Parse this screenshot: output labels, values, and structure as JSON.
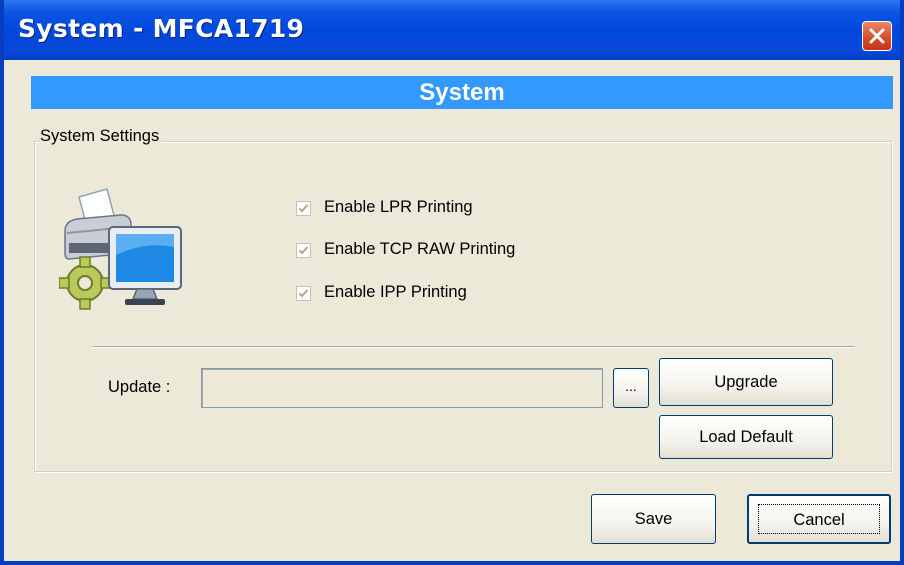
{
  "window": {
    "title": "System - MFCA1719",
    "close_icon": "close-icon",
    "titlebar_color": "#0A54E3",
    "close_color": "#D64A26"
  },
  "banner": {
    "text": "System",
    "color": "#3399FF"
  },
  "settings": {
    "legend": "System Settings",
    "icon": "printer-monitor-gear-icon",
    "options": [
      {
        "label": "Enable LPR Printing",
        "checked": true,
        "disabled": true
      },
      {
        "label": "Enable TCP RAW Printing",
        "checked": true,
        "disabled": true
      },
      {
        "label": "Enable IPP Printing",
        "checked": true,
        "disabled": true
      }
    ]
  },
  "update": {
    "label": "Update :",
    "value": "",
    "browse_label": "...",
    "upgrade_label": "Upgrade",
    "load_default_label": "Load Default"
  },
  "footer": {
    "save_label": "Save",
    "cancel_label": "Cancel"
  }
}
